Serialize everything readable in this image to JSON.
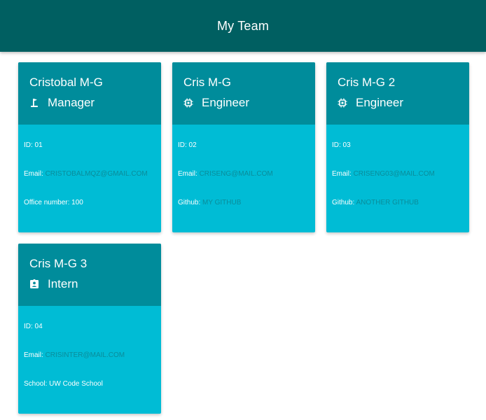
{
  "header": {
    "title": "My Team"
  },
  "colors": {
    "header_bg": "#005f61",
    "card_head_bg": "#008c9b",
    "card_body_bg": "#00bcd5",
    "link_text": "#0a8c9a"
  },
  "cards": [
    {
      "name": "Cristobal M-G",
      "role": "Manager",
      "role_icon": "golf-flag-icon",
      "id": "ID: 01",
      "email_label": "Email:",
      "email": "CRISTOBALMQZ@GMAIL.COM",
      "third_line": "Office number: 100"
    },
    {
      "name": "Cris M-G",
      "role": "Engineer",
      "role_icon": "chip-icon",
      "id": "ID: 02",
      "email_label": "Email:",
      "email": "CRISENG@MAIL.COM",
      "third_label": "Github:",
      "third_link": "MY GITHUB"
    },
    {
      "name": "Cris M-G 2",
      "role": "Engineer",
      "role_icon": "chip-icon",
      "id": "ID: 03",
      "email_label": "Email:",
      "email": "CRISENG03@MAIL.COM",
      "third_label": "Github:",
      "third_link": "ANOTHER GITHUB"
    },
    {
      "name": "Cris M-G 3",
      "role": "Intern",
      "role_icon": "id-badge-icon",
      "id": "ID: 04",
      "email_label": "Email:",
      "email": "CRISINTER@MAIL.COM",
      "third_line": "School: UW Code School"
    }
  ]
}
